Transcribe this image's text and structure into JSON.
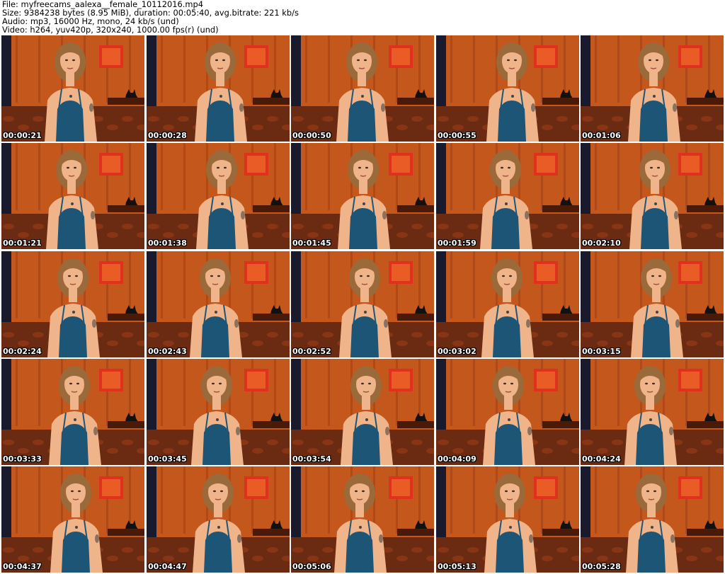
{
  "header": {
    "file_line": "File: myfreecams_aalexa__female_10112016.mp4",
    "size_line": "Size: 9384238 bytes (8.95 MiB), duration: 00:05:40, avg.bitrate: 221 kb/s",
    "audio_line": "Audio: mp3, 16000 Hz, mono, 24 kb/s (und)",
    "video_line": "Video: h264, yuv420p, 320x240, 1000.00 fps(r) (und)"
  },
  "thumbnails": [
    {
      "timestamp": "00:00:21"
    },
    {
      "timestamp": "00:00:28"
    },
    {
      "timestamp": "00:00:50"
    },
    {
      "timestamp": "00:00:55"
    },
    {
      "timestamp": "00:01:06"
    },
    {
      "timestamp": "00:01:21"
    },
    {
      "timestamp": "00:01:38"
    },
    {
      "timestamp": "00:01:45"
    },
    {
      "timestamp": "00:01:59"
    },
    {
      "timestamp": "00:02:10"
    },
    {
      "timestamp": "00:02:24"
    },
    {
      "timestamp": "00:02:43"
    },
    {
      "timestamp": "00:02:52"
    },
    {
      "timestamp": "00:03:02"
    },
    {
      "timestamp": "00:03:15"
    },
    {
      "timestamp": "00:03:33"
    },
    {
      "timestamp": "00:03:45"
    },
    {
      "timestamp": "00:03:54"
    },
    {
      "timestamp": "00:04:09"
    },
    {
      "timestamp": "00:04:24"
    },
    {
      "timestamp": "00:04:37"
    },
    {
      "timestamp": "00:04:47"
    },
    {
      "timestamp": "00:05:06"
    },
    {
      "timestamp": "00:05:13"
    },
    {
      "timestamp": "00:05:28"
    }
  ],
  "colors": {
    "wall": "#c4571c",
    "wall_dark": "#8a3210",
    "curtain": "#1a1a2e",
    "picture": "#e0301e",
    "bed": "#6b2a12",
    "skin": "#f0b48a",
    "hair": "#9a6a3a",
    "top": "#1d5577"
  }
}
